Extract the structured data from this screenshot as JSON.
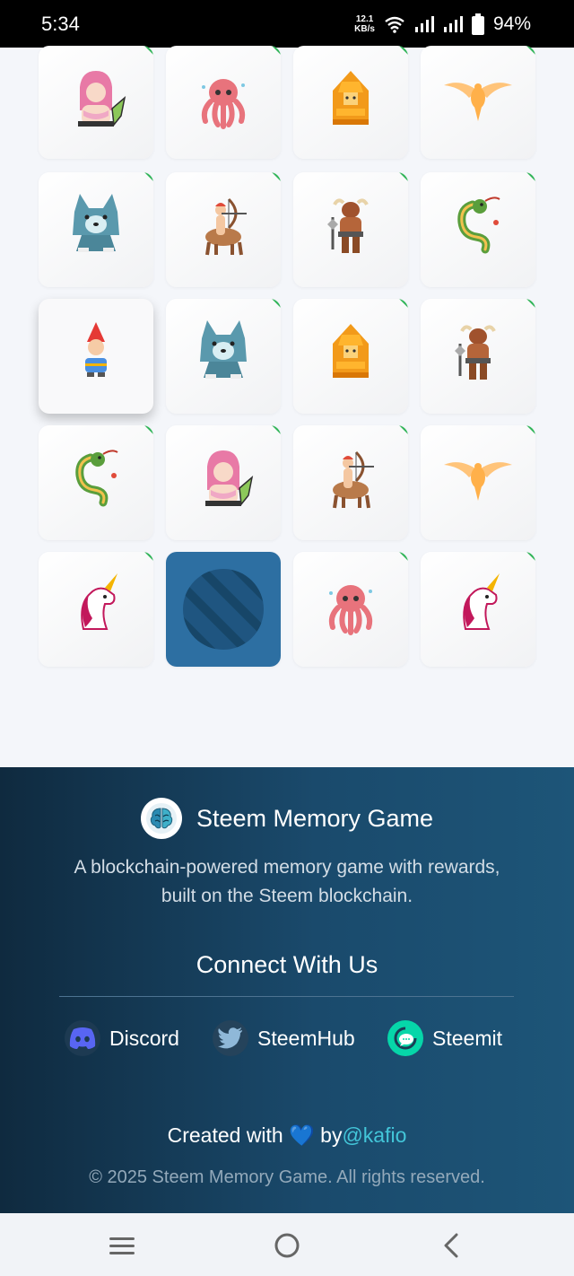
{
  "status_bar": {
    "time": "5:34",
    "net_speed_value": "12.1",
    "net_speed_unit": "KB/s",
    "battery": "94%"
  },
  "board": {
    "cards": [
      {
        "icon": "mermaid-icon",
        "state": "matched"
      },
      {
        "icon": "octopus-icon",
        "state": "matched"
      },
      {
        "icon": "sphinx-icon",
        "state": "matched"
      },
      {
        "icon": "phoenix-icon",
        "state": "matched"
      },
      {
        "icon": "werewolf-icon",
        "state": "matched"
      },
      {
        "icon": "centaur-icon",
        "state": "matched"
      },
      {
        "icon": "minotaur-icon",
        "state": "matched"
      },
      {
        "icon": "dragon-icon",
        "state": "matched"
      },
      {
        "icon": "gnome-icon",
        "state": "selected"
      },
      {
        "icon": "werewolf-icon",
        "state": "matched"
      },
      {
        "icon": "sphinx-icon",
        "state": "matched"
      },
      {
        "icon": "minotaur-icon",
        "state": "matched"
      },
      {
        "icon": "dragon-icon",
        "state": "matched"
      },
      {
        "icon": "mermaid-icon",
        "state": "matched"
      },
      {
        "icon": "centaur-icon",
        "state": "matched"
      },
      {
        "icon": "phoenix-icon",
        "state": "matched"
      },
      {
        "icon": "unicorn-icon",
        "state": "matched"
      },
      {
        "icon": "card-back-icon",
        "state": "hidden"
      },
      {
        "icon": "octopus-icon",
        "state": "matched"
      },
      {
        "icon": "unicorn-icon",
        "state": "matched"
      }
    ]
  },
  "footer": {
    "brand_title": "Steem Memory Game",
    "description": "A blockchain-powered memory game with rewards, built on the Steem blockchain.",
    "connect_title": "Connect With Us",
    "social": [
      {
        "label": "Discord",
        "icon": "discord-icon",
        "color": "#5865f2"
      },
      {
        "label": "SteemHub",
        "icon": "twitter-bird-icon",
        "color": "#1da1f2"
      },
      {
        "label": "Steemit",
        "icon": "steemit-icon",
        "color": "#06d6a9"
      }
    ],
    "credit_prefix": "Created with",
    "credit_heart": "💙",
    "credit_by": "by",
    "credit_author": "@kafio",
    "copyright": "© 2025 Steem Memory Game. All rights reserved."
  },
  "colors": {
    "matched_marker": "#2fb457",
    "card_back": "#2d6fa2",
    "footer_gradient_start": "#0f2a3f",
    "footer_gradient_end": "#1d5578",
    "author_link": "#43c6d9"
  }
}
